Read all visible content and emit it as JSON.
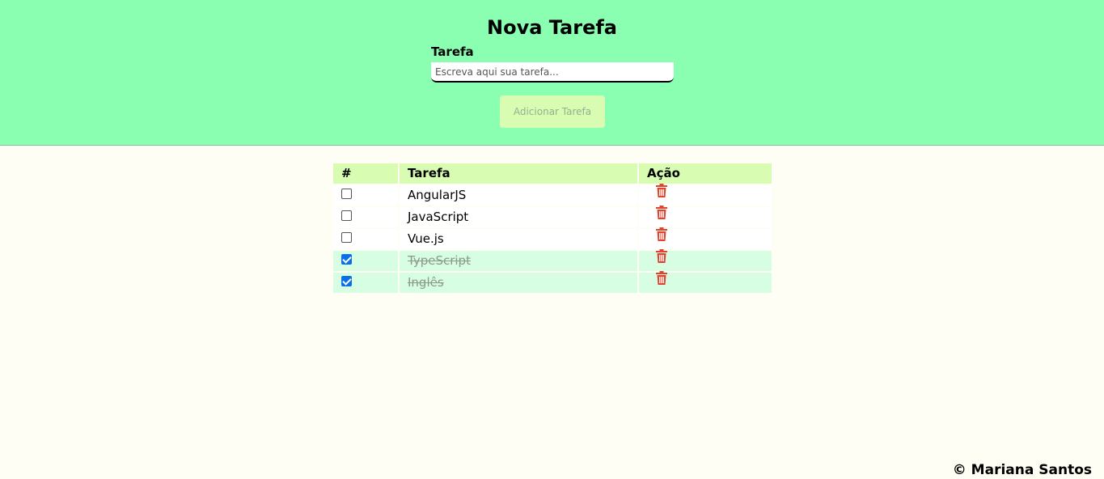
{
  "header": {
    "title": "Nova Tarefa",
    "field_label": "Tarefa",
    "input_placeholder": "Escreva aqui sua tarefa...",
    "input_value": "",
    "add_button": "Adicionar Tarefa"
  },
  "table": {
    "columns": [
      "#",
      "Tarefa",
      "Ação"
    ],
    "rows": [
      {
        "task": "AngularJS",
        "done": false
      },
      {
        "task": "JavaScript",
        "done": false
      },
      {
        "task": "Vue.js",
        "done": false
      },
      {
        "task": "TypeScript",
        "done": true
      },
      {
        "task": "Inglês",
        "done": true
      }
    ]
  },
  "footer": {
    "text": "© Mariana Santos"
  },
  "colors": {
    "header_bg": "#8affb2",
    "table_header_bg": "#d8fdb2",
    "done_row_bg": "#d7fde2",
    "trash": "#e0442c",
    "page_bg": "#fffef4"
  },
  "icons": {
    "delete": "trash-icon"
  }
}
